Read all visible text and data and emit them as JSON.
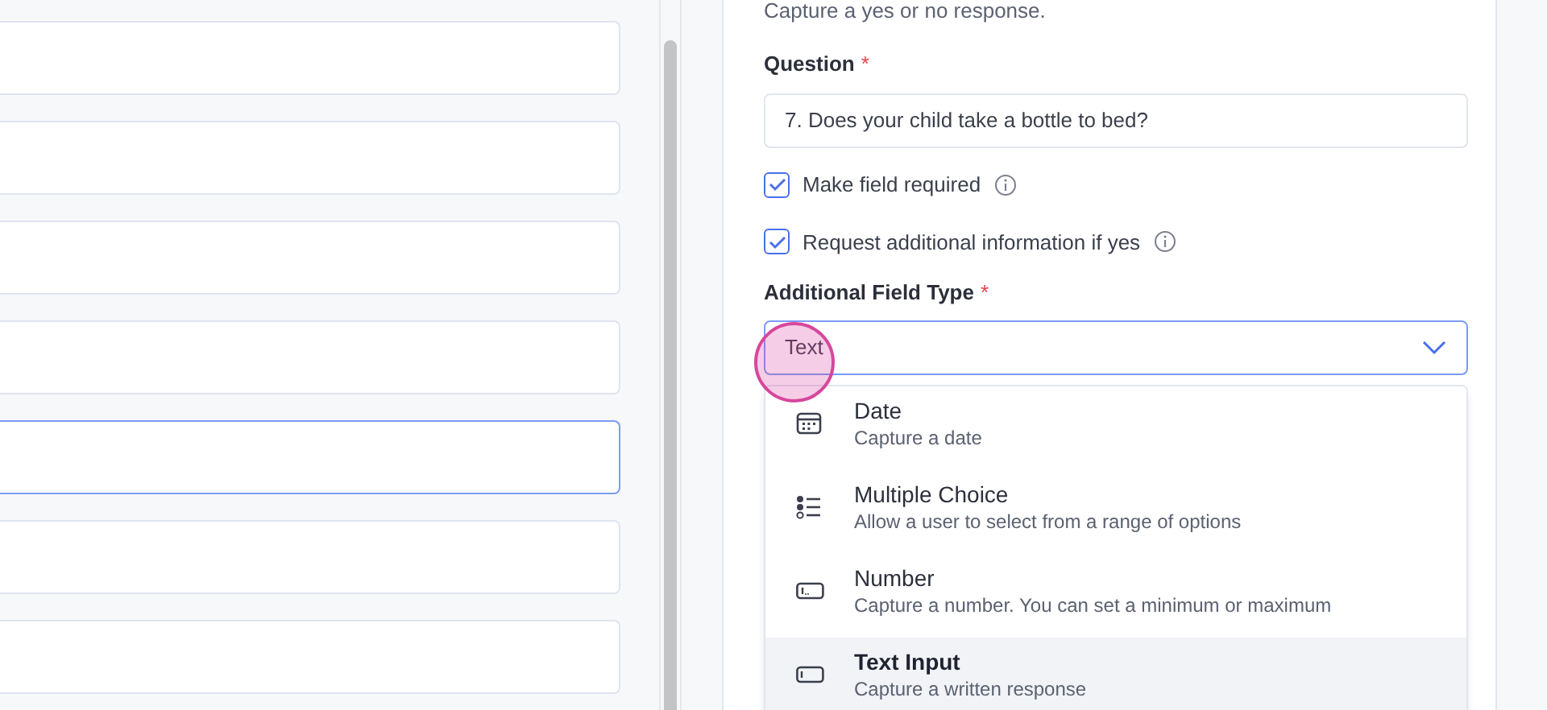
{
  "field_list": {
    "cards": [
      {
        "selected": false
      },
      {
        "selected": false
      },
      {
        "selected": false
      },
      {
        "selected": false
      },
      {
        "selected": true
      },
      {
        "selected": false
      },
      {
        "selected": false
      }
    ]
  },
  "editor": {
    "description": "Capture a yes or no response.",
    "question": {
      "label": "Question",
      "required_mark": "*",
      "value": "7. Does your child take a bottle to bed?"
    },
    "checkboxes": [
      {
        "label": "Make field required",
        "checked": true
      },
      {
        "label": "Request additional information if yes",
        "checked": true
      }
    ],
    "additional_field_type": {
      "label": "Additional Field Type",
      "required_mark": "*",
      "value": "Text",
      "expanded": true,
      "options": [
        {
          "kind": "date",
          "label": "Date",
          "description": "Capture a date",
          "selected": false
        },
        {
          "kind": "choice",
          "label": "Multiple Choice",
          "description": "Allow a user to select from a range of options",
          "selected": false
        },
        {
          "kind": "number",
          "label": "Number",
          "description": "Capture a number. You can set a minimum or maximum",
          "selected": false
        },
        {
          "kind": "text",
          "label": "Text Input",
          "description": "Capture a written response",
          "selected": true
        }
      ]
    }
  }
}
